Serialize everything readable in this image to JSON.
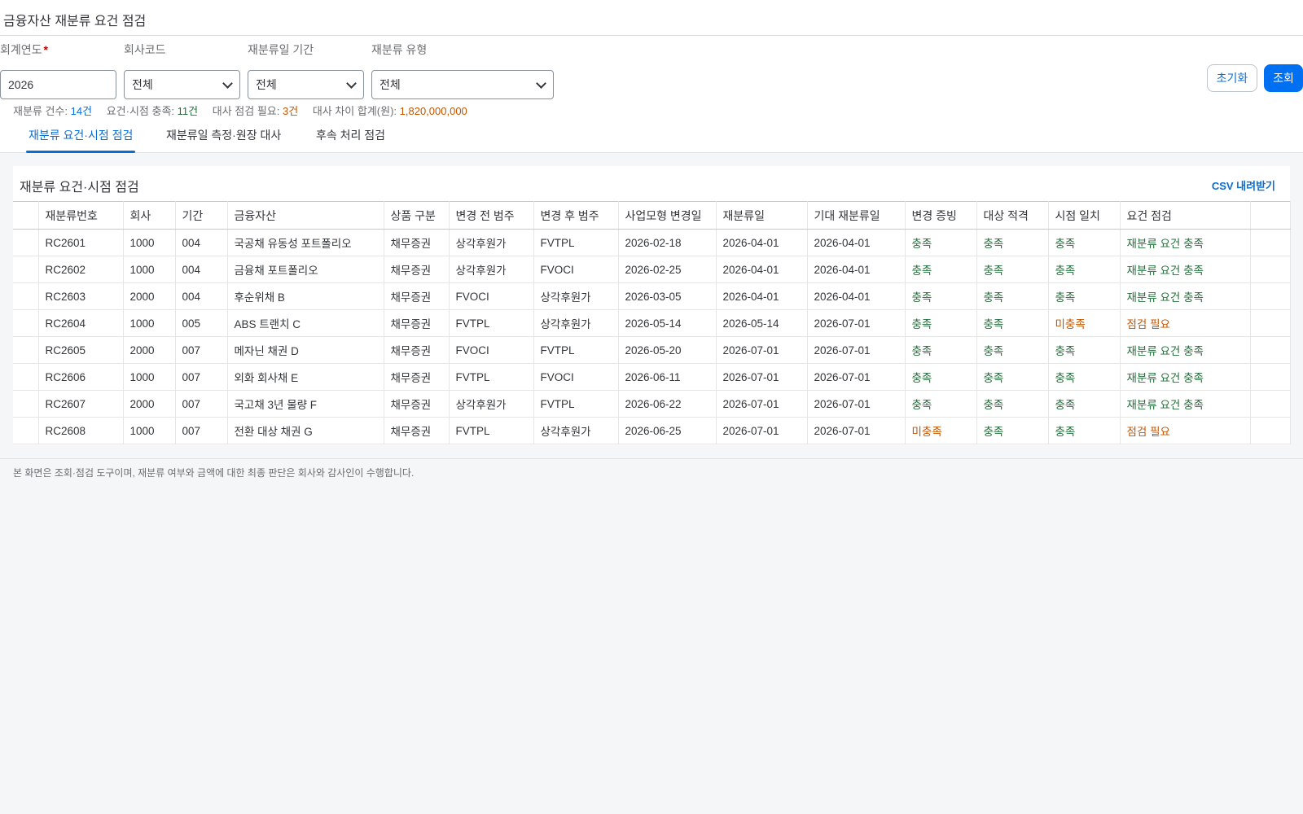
{
  "page": {
    "title": "금융자산 재분류 요건 점검"
  },
  "filters": {
    "fiscal_year": {
      "label": "회계연도",
      "required_mark": "*",
      "value": "2026"
    },
    "company_code": {
      "label": "회사코드",
      "value": "전체"
    },
    "reclass_period": {
      "label": "재분류일 기간",
      "value": "전체"
    },
    "reclass_type": {
      "label": "재분류 유형",
      "value": "전체"
    }
  },
  "buttons": {
    "reset": "초기화",
    "search": "조회"
  },
  "summary": {
    "count_label": "재분류 건수:",
    "count_value": "14건",
    "met_label": "요건·시점 충족:",
    "met_value": "11건",
    "review_label": "대사 점검 필요:",
    "review_value": "3건",
    "diff_label": "대사 차이 합계(원):",
    "diff_value": "1,820,000,000"
  },
  "tabs": [
    {
      "label": "재분류 요건·시점 점검",
      "active": true
    },
    {
      "label": "재분류일 측정·원장 대사",
      "active": false
    },
    {
      "label": "후속 처리 점검",
      "active": false
    }
  ],
  "panel": {
    "title": "재분류 요건·시점 점검",
    "csv_label": "CSV 내려받기"
  },
  "table": {
    "columns": [
      "재분류번호",
      "회사",
      "기간",
      "금융자산",
      "상품 구분",
      "변경 전 범주",
      "변경 후 범주",
      "사업모형 변경일",
      "재분류일",
      "기대 재분류일",
      "변경 증빙",
      "대상 적격",
      "시점 일치",
      "요건 점검"
    ],
    "rows": [
      [
        "RC2601",
        "1000",
        "004",
        "국공채 유동성 포트폴리오",
        "채무증권",
        "상각후원가",
        "FVTPL",
        "2026-02-18",
        "2026-04-01",
        "2026-04-01",
        "충족",
        "충족",
        "충족",
        "재분류 요건 충족"
      ],
      [
        "RC2602",
        "1000",
        "004",
        "금융채 포트폴리오",
        "채무증권",
        "상각후원가",
        "FVOCI",
        "2026-02-25",
        "2026-04-01",
        "2026-04-01",
        "충족",
        "충족",
        "충족",
        "재분류 요건 충족"
      ],
      [
        "RC2603",
        "2000",
        "004",
        "후순위채 B",
        "채무증권",
        "FVOCI",
        "상각후원가",
        "2026-03-05",
        "2026-04-01",
        "2026-04-01",
        "충족",
        "충족",
        "충족",
        "재분류 요건 충족"
      ],
      [
        "RC2604",
        "1000",
        "005",
        "ABS 트랜치 C",
        "채무증권",
        "FVTPL",
        "상각후원가",
        "2026-05-14",
        "2026-05-14",
        "2026-07-01",
        "충족",
        "충족",
        "미충족",
        "점검 필요"
      ],
      [
        "RC2605",
        "2000",
        "007",
        "메자닌 채권 D",
        "채무증권",
        "FVOCI",
        "FVTPL",
        "2026-05-20",
        "2026-07-01",
        "2026-07-01",
        "충족",
        "충족",
        "충족",
        "재분류 요건 충족"
      ],
      [
        "RC2606",
        "1000",
        "007",
        "외화 회사채 E",
        "채무증권",
        "FVTPL",
        "FVOCI",
        "2026-06-11",
        "2026-07-01",
        "2026-07-01",
        "충족",
        "충족",
        "충족",
        "재분류 요건 충족"
      ],
      [
        "RC2607",
        "2000",
        "007",
        "국고채 3년 물량 F",
        "채무증권",
        "상각후원가",
        "FVTPL",
        "2026-06-22",
        "2026-07-01",
        "2026-07-01",
        "충족",
        "충족",
        "충족",
        "재분류 요건 충족"
      ],
      [
        "RC2608",
        "1000",
        "007",
        "전환 대상 채권 G",
        "채무증권",
        "FVTPL",
        "상각후원가",
        "2026-06-25",
        "2026-07-01",
        "2026-07-01",
        "미충족",
        "충족",
        "충족",
        "점검 필요"
      ]
    ]
  },
  "footer": {
    "note": "본 화면은 조회·점검 도구이며, 재분류 여부와 금액에 대한 최종 판단은 회사와 감사인이 수행합니다."
  },
  "colors": {
    "accent": "#0a6ed1",
    "ok": "#256f3a",
    "warn": "#c35500",
    "primary_button": "#0070f2"
  }
}
